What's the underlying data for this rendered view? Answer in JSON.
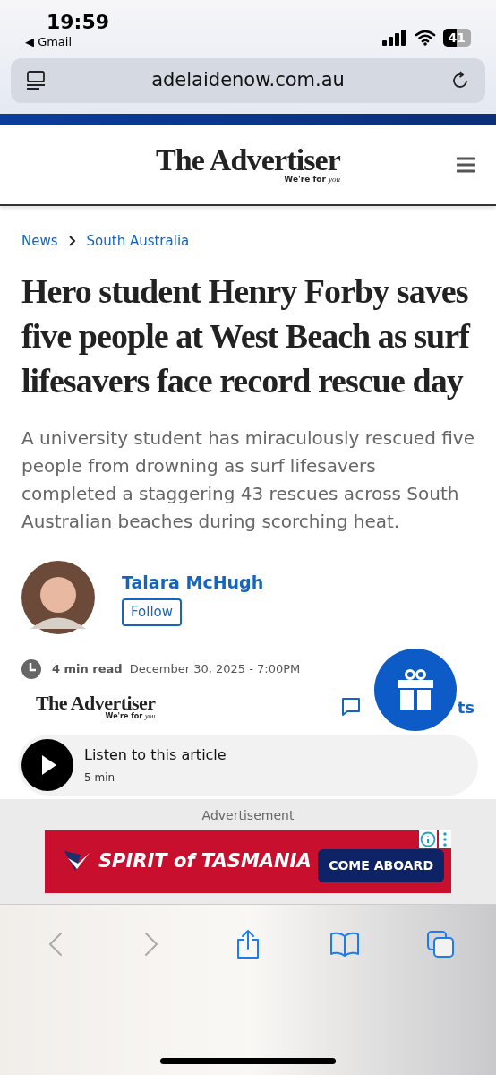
{
  "status_bar": {
    "time": "19:59",
    "back_app": "◀ Gmail",
    "battery": "41"
  },
  "url_bar": {
    "url": "adelaidenow.com.au"
  },
  "header": {
    "logo": "The Advertiser",
    "tagline": "We're for",
    "tagline_script": "you"
  },
  "breadcrumb": [
    "News",
    "South Australia"
  ],
  "headline": "Hero student Henry Forby saves five people at West Beach as surf lifesavers face record rescue day",
  "standfirst": "A university student has miraculously rescued five people from drowning as surf lifesavers completed a staggering 43 rescues across South Australian beaches during scorching heat.",
  "author": {
    "name": "Talara McHugh",
    "follow": "Follow"
  },
  "meta": {
    "read_time": "4 min read",
    "date": "December 30, 2025 - 7:00PM"
  },
  "publisher": {
    "logo": "The Advertiser",
    "tagline": "We're for",
    "tagline_script": "you",
    "comments": "ts"
  },
  "listen": {
    "title": "Listen to this article",
    "duration": "5 min"
  },
  "ad": {
    "label": "Advertisement",
    "brand": "SPIRIT of TASMANIA",
    "cta": "COME ABOARD"
  },
  "toolbar": [
    {
      "kind": "back",
      "disabled": true
    },
    {
      "kind": "forward",
      "disabled": true
    },
    {
      "kind": "share",
      "disabled": false
    },
    {
      "kind": "bookmarks",
      "disabled": false
    },
    {
      "kind": "tabs",
      "disabled": false
    }
  ]
}
